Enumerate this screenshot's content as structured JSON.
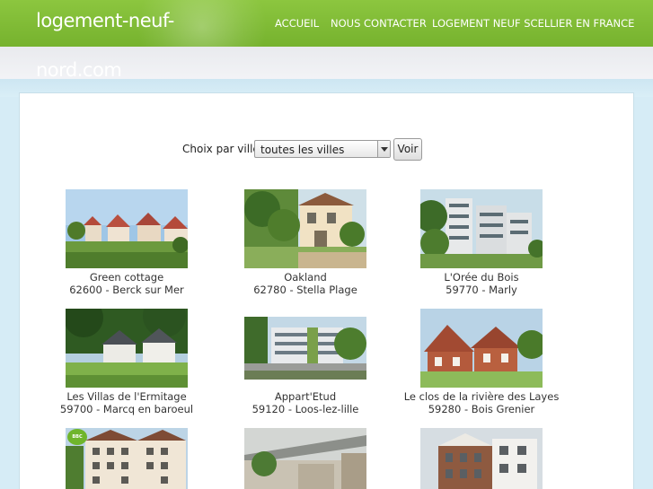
{
  "header": {
    "logo_line1": "logement-neuf-",
    "logo_line2": "nord.com",
    "nav": [
      {
        "label": "ACCUEIL"
      },
      {
        "label": "NOUS CONTACTER"
      },
      {
        "label": "LOGEMENT NEUF SCELLIER EN FRANCE"
      }
    ]
  },
  "filter": {
    "label": "Choix par ville",
    "selected": "toutes les villes",
    "button": "Voir"
  },
  "listings": [
    {
      "name": "Green cottage",
      "location": "62600 - Berck sur Mer"
    },
    {
      "name": "Oakland",
      "location": "62780 - Stella Plage"
    },
    {
      "name": "L'Orée du Bois",
      "location": "59770 - Marly"
    },
    {
      "name": "Les Villas de l'Ermitage",
      "location": "59700 - Marcq en baroeul"
    },
    {
      "name": "Appart'Etud",
      "location": "59120 - Loos-lez-lille"
    },
    {
      "name": "Le clos de la rivière des Layes",
      "location": "59280 - Bois Grenier"
    },
    {
      "name": "",
      "location": "",
      "badge": "BBC"
    },
    {
      "name": "",
      "location": ""
    },
    {
      "name": "",
      "location": ""
    }
  ],
  "colors": {
    "header_green": "#7ab833",
    "page_bg": "#d6ecf6"
  }
}
